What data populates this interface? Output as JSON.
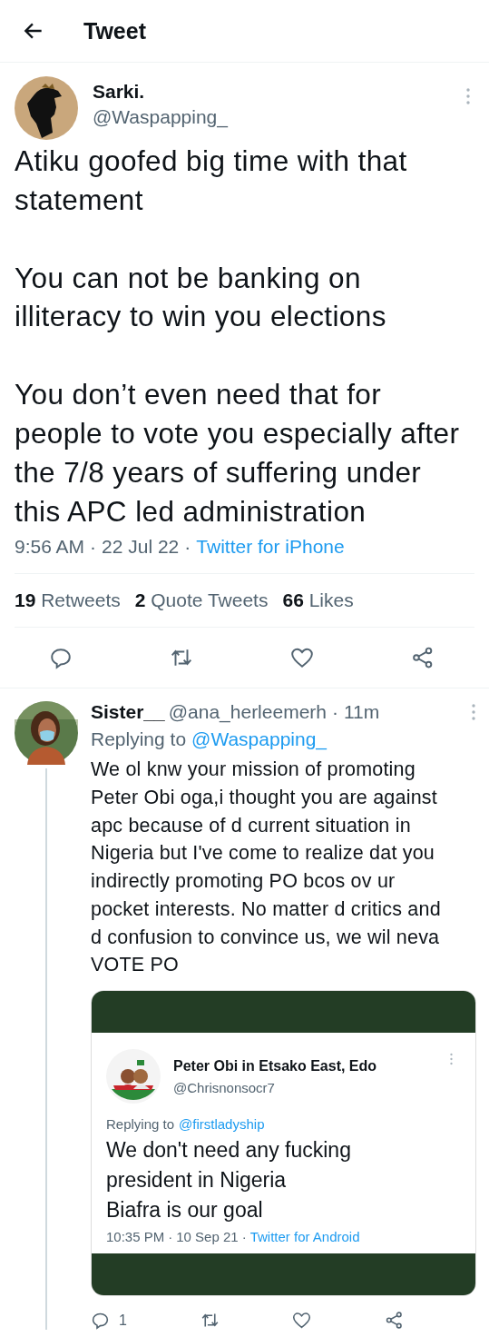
{
  "header": {
    "title": "Tweet"
  },
  "tweet": {
    "name": "Sarki.",
    "handle": "@Waspapping_",
    "paragraphs": [
      "Atiku goofed big time with that\nstatement",
      "You can not be banking on\nilliteracy to win you elections",
      "You don’t even need that for\npeople to vote you especially after\nthe 7/8 years of suffering under\nthis APC led administration"
    ],
    "separator": "·",
    "time": "9:56 AM",
    "date": "22 Jul 22",
    "source": "Twitter for iPhone",
    "stats": [
      {
        "count": "19",
        "label": "Retweets"
      },
      {
        "count": "2",
        "label": "Quote Tweets"
      },
      {
        "count": "66",
        "label": "Likes"
      }
    ]
  },
  "reply": {
    "name": "Sister__",
    "handle": "@ana_herleemerh",
    "age": "11m",
    "replying_prefix": "Replying to",
    "replying_to": "@Waspapping_",
    "separator": "·",
    "text": "We ol knw your mission of promoting\nPeter Obi oga,i thought you are against\napc because of d current situation in\nNigeria but I've come to realize dat you\nindirectly promoting PO bcos ov ur\npocket interests. No matter d critics and\nd confusion to convince us, we wil neva\nVOTE PO",
    "embedded": {
      "name": "Peter Obi in Etsako East, Edo",
      "handle": "@Chrisnonsocr7",
      "replying_prefix": "Replying to",
      "replying_to": "@firstladyship",
      "lines": [
        "We don't need any fucking",
        "president in Nigeria",
        "Biafra is our goal"
      ],
      "time": "10:35 PM",
      "separator": "·",
      "date": "10 Sep 21",
      "source": "Twitter for Android"
    },
    "reply_count": "1"
  }
}
